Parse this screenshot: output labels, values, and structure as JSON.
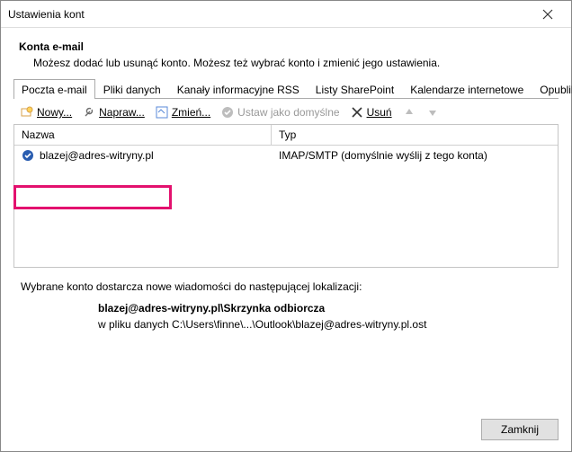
{
  "window": {
    "title": "Ustawienia kont"
  },
  "section": {
    "heading": "Konta e-mail",
    "description": "Możesz dodać lub usunąć konto. Możesz też wybrać konto i zmienić jego ustawienia."
  },
  "tabs": {
    "items": [
      "Poczta e-mail",
      "Pliki danych",
      "Kanały informacyjne RSS",
      "Listy SharePoint",
      "Kalendarze internetowe",
      "Opublikowa"
    ],
    "active_index": 0
  },
  "toolbar": {
    "new_label": "Nowy... ",
    "repair_label": "Napraw... ",
    "change_label": "Zmień... ",
    "set_default_label": "Ustaw jako domyślne",
    "remove_label": "Usuń"
  },
  "list": {
    "columns": {
      "name": "Nazwa",
      "type": "Typ"
    },
    "rows": [
      {
        "name": "blazej@adres-witryny.pl",
        "type": "IMAP/SMTP (domyślnie wyślij z tego konta)"
      }
    ]
  },
  "delivery": {
    "intro": "Wybrane konto dostarcza nowe wiadomości do następującej lokalizacji:",
    "location_bold": "blazej@adres-witryny.pl\\Skrzynka odbiorcza",
    "location_path": "w pliku danych C:\\Users\\finne\\...\\Outlook\\blazej@adres-witryny.pl.ost"
  },
  "footer": {
    "close_label": "Zamknij"
  }
}
